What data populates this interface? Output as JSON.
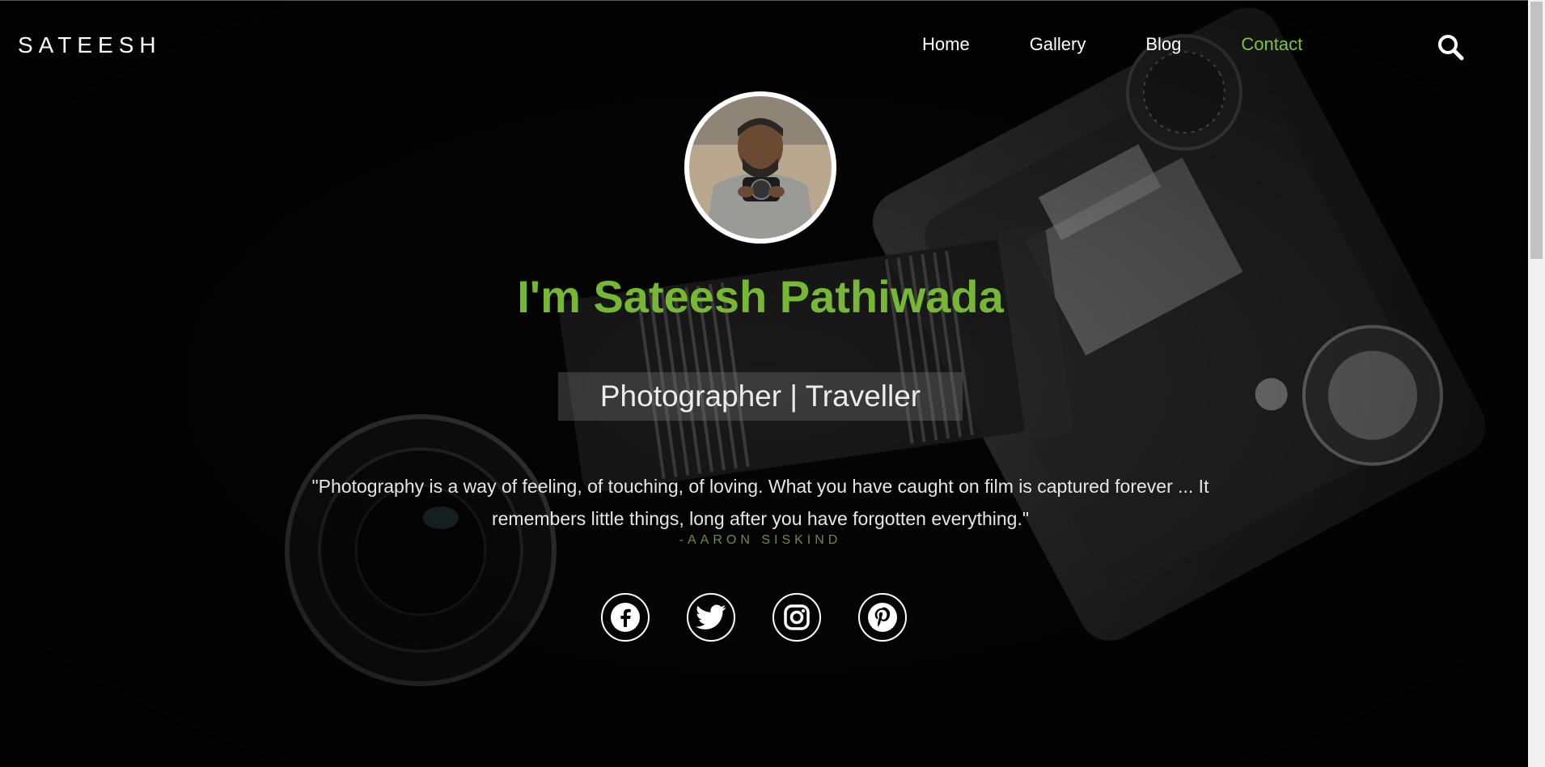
{
  "brand": {
    "logo": "SATEESH"
  },
  "nav": {
    "items": [
      {
        "label": "Home",
        "active": false
      },
      {
        "label": "Gallery",
        "active": false
      },
      {
        "label": "Blog",
        "active": false
      },
      {
        "label": "Contact",
        "active": true
      }
    ],
    "search_icon": "search-icon"
  },
  "hero": {
    "title": "I'm Sateesh Pathiwada",
    "subtitle": "Photographer | Traveller",
    "quote": "\"Photography is a way of feeling, of touching, of loving. What you have caught on film is captured forever ... It remembers little things, long after you have forgotten everything.\"",
    "quote_author": "-AARON SISKIND"
  },
  "socials": [
    {
      "name": "facebook-icon"
    },
    {
      "name": "twitter-icon"
    },
    {
      "name": "instagram-icon"
    },
    {
      "name": "pinterest-icon"
    }
  ],
  "colors": {
    "accent": "#76b833",
    "active_nav": "#7cc243",
    "background": "#050505",
    "author": "#6d8a4a"
  }
}
